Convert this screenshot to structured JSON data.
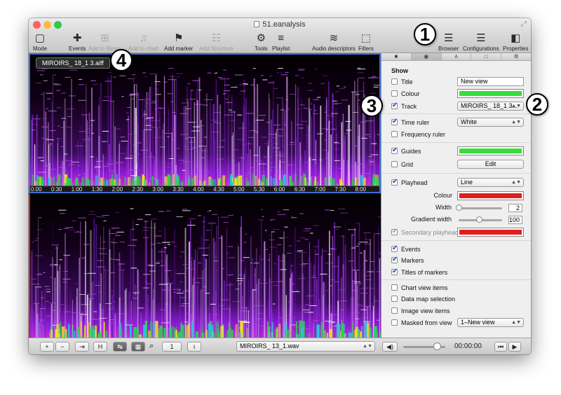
{
  "window": {
    "title": "51.eanalysis",
    "traffic_colors": [
      "#fc605c",
      "#fdbc40",
      "#34c84a"
    ]
  },
  "toolbar": {
    "items": [
      {
        "label": "Mode",
        "icon": "square-icon",
        "glyph": "▢",
        "enabled": true
      },
      {
        "label": "Events",
        "icon": "plus-icon",
        "glyph": "✚",
        "enabled": true
      },
      {
        "label": "Add to library",
        "icon": "grid-plus-icon",
        "glyph": "⊞",
        "enabled": false
      },
      {
        "label": "Add to chart",
        "icon": "music-note-icon",
        "glyph": "♫",
        "enabled": false
      },
      {
        "label": "Add marker",
        "icon": "flag-icon",
        "glyph": "⚑",
        "enabled": true
      },
      {
        "label": "Add Structure",
        "icon": "structure-icon",
        "glyph": "☷",
        "enabled": false
      },
      {
        "label": "Tools",
        "icon": "gear-icon",
        "glyph": "⚙",
        "enabled": true
      },
      {
        "label": "Playlist",
        "icon": "list-icon",
        "glyph": "≡",
        "enabled": true
      },
      {
        "label": "Audio descriptors",
        "icon": "waveform-icon",
        "glyph": "≋",
        "enabled": true
      },
      {
        "label": "Filters",
        "icon": "filter-icon",
        "glyph": "⬚",
        "enabled": true
      },
      {
        "label": "Browser",
        "icon": "browser-icon",
        "glyph": "☰",
        "enabled": true
      },
      {
        "label": "Configurations",
        "icon": "configurations-icon",
        "glyph": "☰",
        "enabled": true
      },
      {
        "label": "Properties",
        "icon": "properties-icon",
        "glyph": "◧",
        "enabled": true
      }
    ]
  },
  "views": {
    "label": "MIROIRS_ 18_1 3.aiff",
    "ruler_ticks": [
      "0:00",
      "0:30",
      "1:00",
      "1:30",
      "2:00",
      "2:30",
      "3:00",
      "3:30",
      "4:00",
      "4:30",
      "5:00",
      "5:30",
      "6:00",
      "6:30",
      "7:00",
      "7:30",
      "8:00"
    ]
  },
  "bottombar": {
    "plus": "+",
    "minus": "−",
    "fit": "⇥",
    "h": "H",
    "b5": "↹",
    "b6": "▦",
    "zoom_icon": "⌕",
    "page": "1",
    "info": "i",
    "file": "MIROIRS_ 13_1.wav",
    "volume_icon": "◀)",
    "volume": 0.8,
    "time": "00:00:00",
    "prev": "⏮",
    "play": "▶"
  },
  "panel": {
    "tabs": [
      "■",
      "◉",
      "∧",
      "□",
      "⚙"
    ],
    "active_tab": 1,
    "heading": "Show",
    "title": {
      "label": "Title",
      "checked": false,
      "value": "New view"
    },
    "colour": {
      "label": "Colour",
      "checked": false,
      "color": "#3adc3a"
    },
    "track": {
      "label": "Track",
      "checked": true,
      "value": "MIROIRS_ 18_1 3..."
    },
    "time_ruler": {
      "label": "Time ruler",
      "checked": true,
      "value": "White"
    },
    "frequency_ruler": {
      "label": "Frequency ruler",
      "checked": false
    },
    "guides": {
      "label": "Guides",
      "checked": true,
      "color": "#3adc3a"
    },
    "grid": {
      "label": "Grid",
      "checked": false,
      "button": "Edit"
    },
    "playhead": {
      "label": "Playhead",
      "checked": true,
      "value": "Line"
    },
    "ph_colour": {
      "label": "Colour",
      "color": "#e01e1e"
    },
    "width": {
      "label": "Width",
      "value": "2"
    },
    "gradient": {
      "label": "Gradient width",
      "value": "100"
    },
    "secondary": {
      "label": "Secondary playhead",
      "checked": true,
      "color": "#e01e1e"
    },
    "events": {
      "label": "Events",
      "checked": true
    },
    "markers": {
      "label": "Markers",
      "checked": true
    },
    "titles_markers": {
      "label": "Titles of markers",
      "checked": true
    },
    "chart_items": {
      "label": "Chart view items",
      "checked": false
    },
    "data_map": {
      "label": "Data map selection",
      "checked": false
    },
    "image_items": {
      "label": "Image view items",
      "checked": false
    },
    "masked": {
      "label": "Masked from view",
      "checked": false,
      "value": "1–New view"
    }
  },
  "callouts": [
    "1",
    "2",
    "3",
    "4"
  ]
}
